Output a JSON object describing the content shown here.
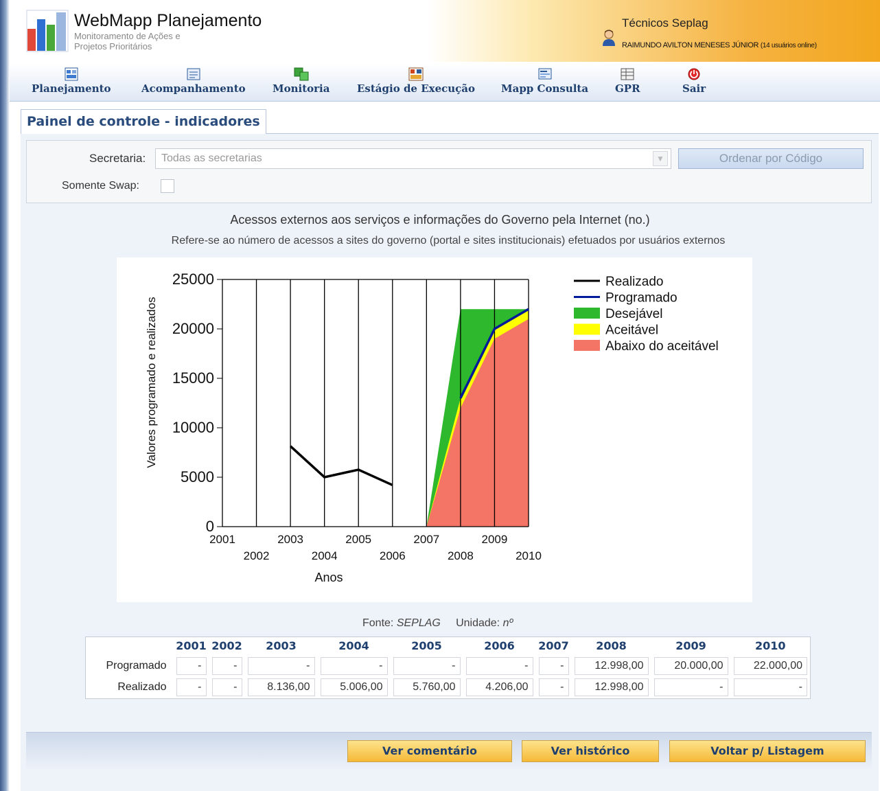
{
  "header": {
    "app_title": "WebMapp Planejamento",
    "app_sub_line1": "Monitoramento de Ações e",
    "app_sub_line2": "Projetos Prioritários",
    "user_group": "Técnicos Seplag",
    "user_name": "RAIMUNDO AVILTON MENESES JÚNIOR",
    "online": "(14 usuários online)"
  },
  "nav": [
    {
      "label": "Planejamento",
      "icon": "planning-icon"
    },
    {
      "label": "Acompanhamento",
      "icon": "tracking-icon"
    },
    {
      "label": "Monitoria",
      "icon": "monitor-icon"
    },
    {
      "label": "Estágio de Execução",
      "icon": "execution-icon"
    },
    {
      "label": "Mapp Consulta",
      "icon": "query-icon"
    },
    {
      "label": "GPR",
      "icon": "gpr-icon"
    },
    {
      "label": "Sair",
      "icon": "power-icon"
    }
  ],
  "tab_title": "Painel de controle - indicadores",
  "filters": {
    "secretaria_label": "Secretaria:",
    "secretaria_value": "Todas as secretarias",
    "swap_label": "Somente Swap:",
    "order_button": "Ordenar por Código"
  },
  "chart_title": "Acessos externos aos serviços e informações do Governo pela Internet (no.)",
  "chart_subtitle": "Refere-se ao número de acessos a sites do governo (portal e sites institucionais) efetuados por usuários externos",
  "chart_data": {
    "type": "area",
    "x": [
      2001,
      2002,
      2003,
      2004,
      2005,
      2006,
      2007,
      2008,
      2009,
      2010
    ],
    "xlabel": "Anos",
    "ylabel": "Valores programado e realizados",
    "ylim": [
      0,
      25000
    ],
    "yticks": [
      0,
      5000,
      10000,
      15000,
      20000,
      25000
    ],
    "grid": true,
    "legend_position": "right",
    "series": [
      {
        "name": "Realizado",
        "type": "line",
        "color": "#000000",
        "x": [
          2003,
          2004,
          2005,
          2006
        ],
        "values": [
          8136,
          5006,
          5760,
          4206
        ]
      },
      {
        "name": "Programado",
        "type": "line",
        "color": "#001a99",
        "x": [
          2008,
          2009,
          2010
        ],
        "values": [
          12998,
          20000,
          22000
        ]
      },
      {
        "name": "Desejável",
        "type": "area",
        "color": "#2db82d",
        "x": [
          2007,
          2008,
          2009,
          2010
        ],
        "values": [
          0,
          22000,
          22000,
          22000
        ]
      },
      {
        "name": "Aceitável",
        "type": "area",
        "color": "#ffff00",
        "x": [
          2007,
          2008,
          2009,
          2010
        ],
        "values": [
          0,
          12998,
          20000,
          22000
        ]
      },
      {
        "name": "Abaixo do aceitável",
        "type": "area",
        "color": "#f47465",
        "x": [
          2007,
          2008,
          2009,
          2010
        ],
        "values": [
          0,
          12000,
          19000,
          21000
        ]
      }
    ]
  },
  "source_label": "Fonte:",
  "source_value": "SEPLAG",
  "unit_label": "Unidade:",
  "unit_value": "nº",
  "table": {
    "years": [
      "2001",
      "2002",
      "2003",
      "2004",
      "2005",
      "2006",
      "2007",
      "2008",
      "2009",
      "2010"
    ],
    "rows": [
      {
        "label": "Programado",
        "values": [
          "-",
          "-",
          "-",
          "-",
          "-",
          "-",
          "-",
          "12.998,00",
          "20.000,00",
          "22.000,00"
        ]
      },
      {
        "label": "Realizado",
        "values": [
          "-",
          "-",
          "8.136,00",
          "5.006,00",
          "5.760,00",
          "4.206,00",
          "-",
          "12.998,00",
          "-",
          "-"
        ]
      }
    ]
  },
  "buttons": {
    "comment": "Ver comentário",
    "history": "Ver histórico",
    "back": "Voltar p/ Listagem"
  }
}
